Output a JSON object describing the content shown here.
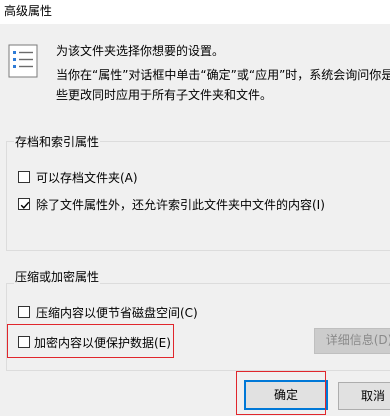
{
  "window": {
    "title": "高级属性"
  },
  "intro": "为该文件夹选择你想要的设置。",
  "description_lines": [
    "当你在“属性”对话框中单击“确定”或“应用”时，系统会询问你是否",
    "些更改同时应用于所有子文件夹和文件。"
  ],
  "archive_group": {
    "title": "存档和索引属性",
    "archive_label": "可以存档文件夹(A)",
    "archive_checked": false,
    "index_label": "除了文件属性外，还允许索引此文件夹中文件的内容(I)",
    "index_checked": true
  },
  "compress_group": {
    "title": "压缩或加密属性",
    "compress_label": "压缩内容以便节省磁盘空间(C)",
    "compress_checked": false,
    "encrypt_label": "加密内容以便保护数据(E)",
    "encrypt_checked": false,
    "details_button": "详细信息(D)"
  },
  "buttons": {
    "ok": "确定",
    "cancel": "取消"
  },
  "colors": {
    "highlight_box": "#e0262c",
    "focus_border": "#0078d7",
    "check": "#000000"
  }
}
